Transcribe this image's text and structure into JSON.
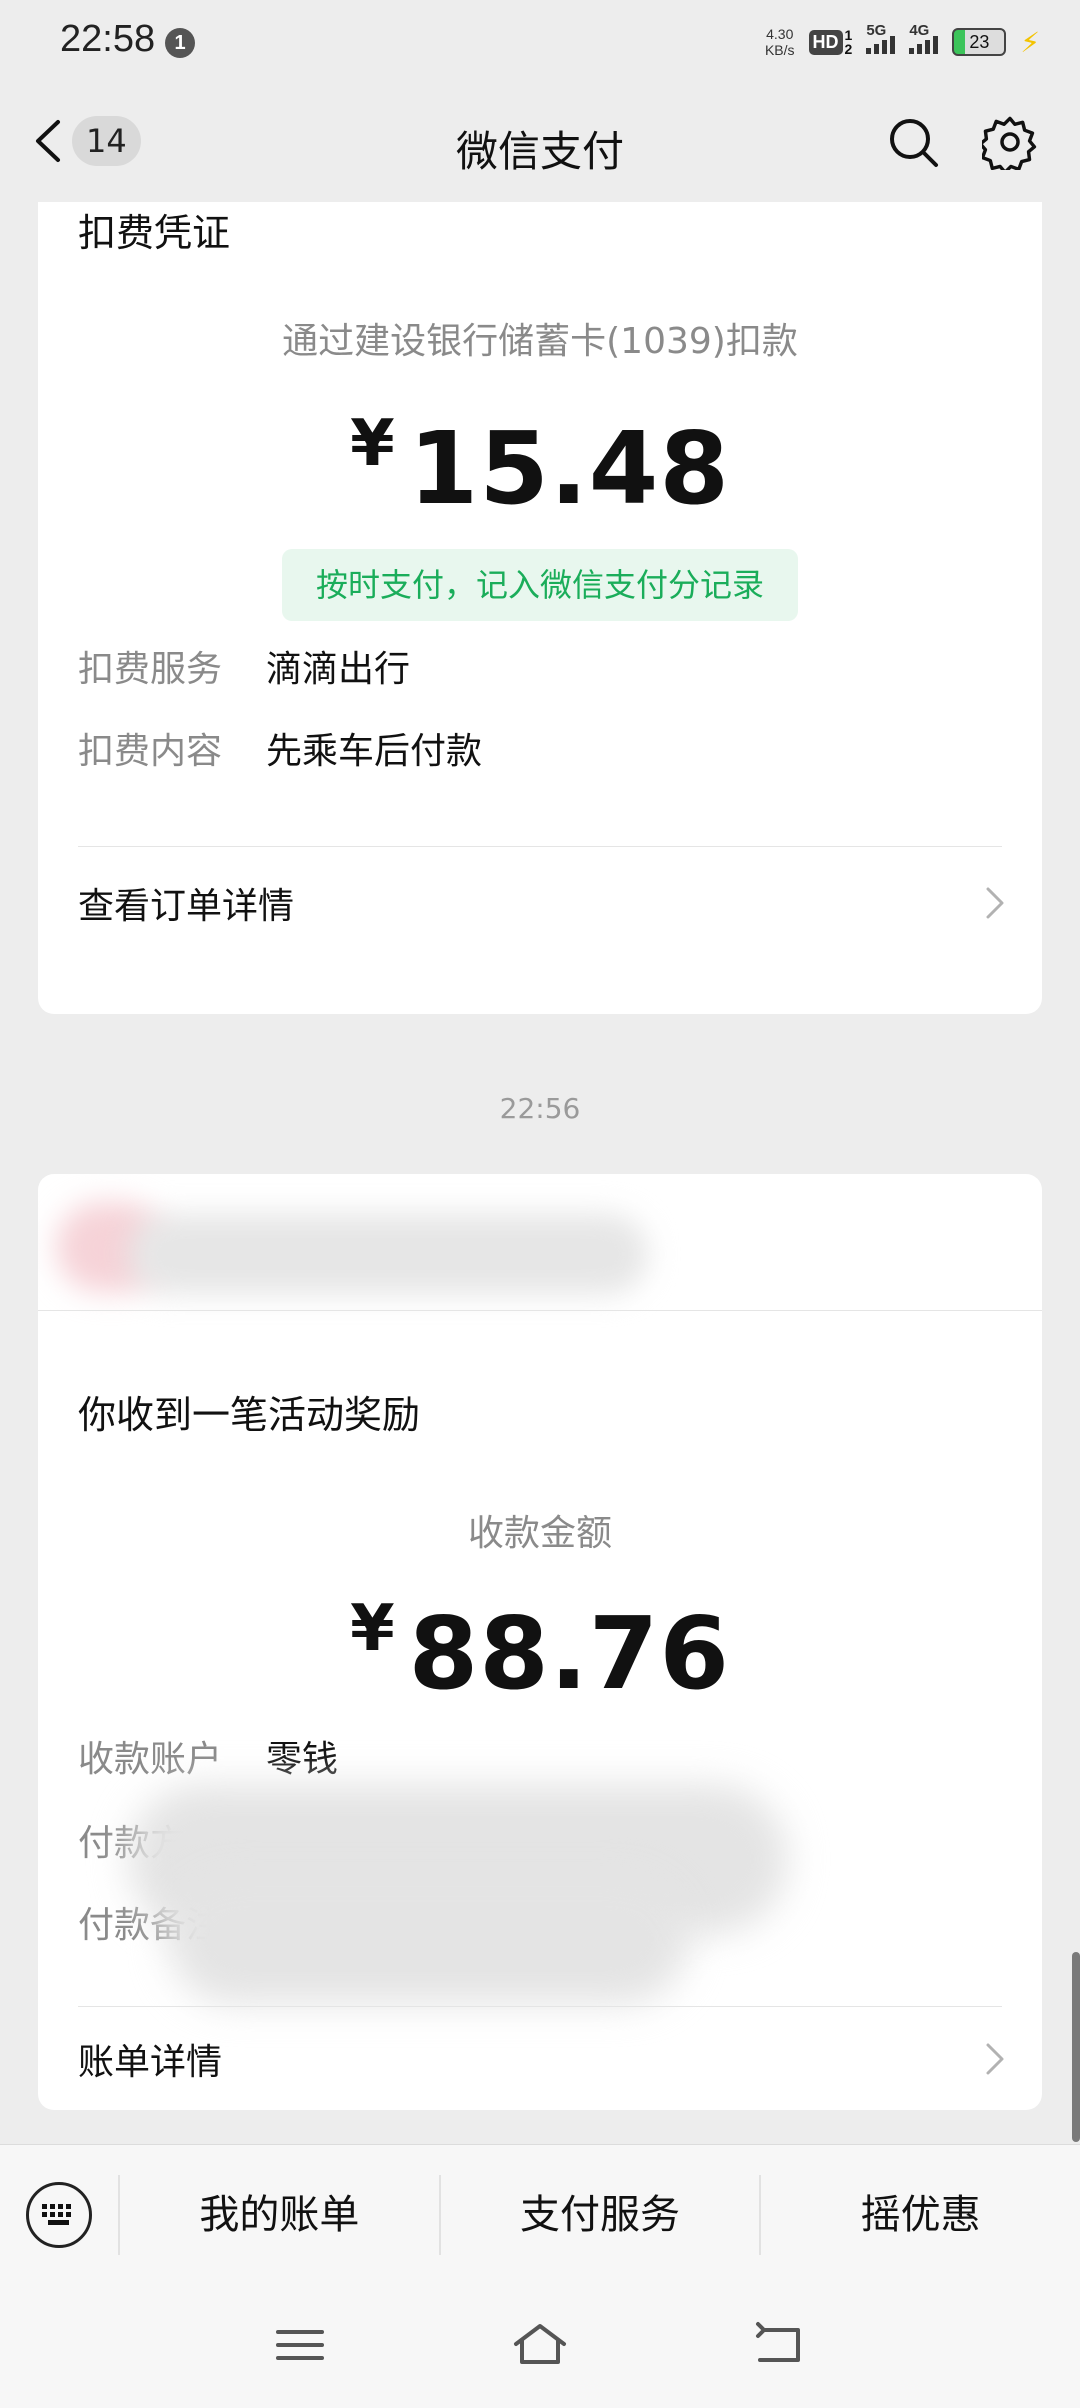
{
  "status_bar": {
    "time": "22:58",
    "notification_count": "1",
    "net_speed_value": "4.30",
    "net_speed_unit": "KB/s",
    "hd_label": "HD",
    "sim1": "1",
    "sim2": "2",
    "signal1_label": "5G",
    "signal2_label": "4G",
    "battery_level": "23"
  },
  "nav": {
    "unread_count": "14",
    "title": "微信支付"
  },
  "card1": {
    "title": "扣费凭证",
    "deduct_desc": "通过建设银行储蓄卡(1039)扣款",
    "currency": "¥",
    "amount": "15.48",
    "badge": "按时支付，记入微信支付分记录",
    "rows": [
      {
        "label": "扣费服务",
        "value": "滴滴出行"
      },
      {
        "label": "扣费内容",
        "value": "先乘车后付款"
      }
    ],
    "link": "查看订单详情"
  },
  "timestamp": "22:56",
  "card2": {
    "title": "你收到一笔活动奖励",
    "recv_label": "收款金额",
    "currency": "¥",
    "amount": "88.76",
    "rows": [
      {
        "label": "收款账户",
        "value": "零钱"
      },
      {
        "label": "付款方",
        "value": ""
      },
      {
        "label": "付款备注",
        "value": ""
      }
    ],
    "link": "账单详情"
  },
  "bottom_menu": {
    "tabs": [
      "我的账单",
      "支付服务",
      "摇优惠"
    ]
  },
  "colors": {
    "accent_green": "#1aad5a",
    "badge_bg": "#e8f7ee",
    "page_bg": "#ededed"
  },
  "icons": {
    "back": "chevron-left-icon",
    "search": "search-icon",
    "settings": "gear-icon",
    "keyboard": "keyboard-icon",
    "chevron": "chevron-right-icon",
    "menu": "menu-icon",
    "home": "home-icon",
    "return": "back-arrow-icon"
  }
}
